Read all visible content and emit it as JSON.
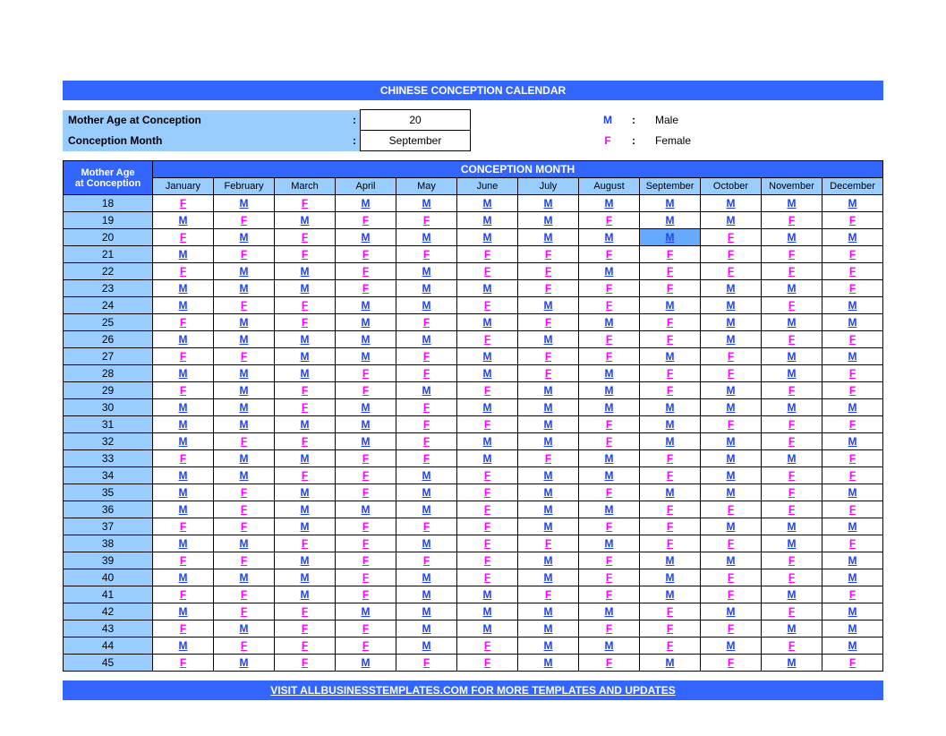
{
  "title": "CHINESE CONCEPTION CALENDAR",
  "inputs": {
    "age_label": "Mother Age at Conception",
    "age_value": "20",
    "month_label": "Conception Month",
    "month_value": "September",
    "colon": ":"
  },
  "legend": {
    "m_key": "M",
    "m_text": "Male",
    "f_key": "F",
    "f_text": "Female",
    "sep": ":"
  },
  "table": {
    "corner_l1": "Mother Age",
    "corner_l2": "at Conception",
    "group": "CONCEPTION MONTH",
    "months": [
      "January",
      "February",
      "March",
      "April",
      "May",
      "June",
      "July",
      "August",
      "September",
      "October",
      "November",
      "December"
    ],
    "highlight": {
      "age": "20",
      "month_index": 8
    }
  },
  "chart_data": {
    "type": "table",
    "title": "Chinese Conception Calendar — predicted gender (M=Male, F=Female)",
    "x_categories": [
      "January",
      "February",
      "March",
      "April",
      "May",
      "June",
      "July",
      "August",
      "September",
      "October",
      "November",
      "December"
    ],
    "y_categories": [
      "18",
      "19",
      "20",
      "21",
      "22",
      "23",
      "24",
      "25",
      "26",
      "27",
      "28",
      "29",
      "30",
      "31",
      "32",
      "33",
      "34",
      "35",
      "36",
      "37",
      "38",
      "39",
      "40",
      "41",
      "42",
      "43",
      "44",
      "45"
    ],
    "rows": [
      {
        "age": "18",
        "v": [
          "F",
          "M",
          "F",
          "M",
          "M",
          "M",
          "M",
          "M",
          "M",
          "M",
          "M",
          "M"
        ]
      },
      {
        "age": "19",
        "v": [
          "M",
          "F",
          "M",
          "F",
          "F",
          "M",
          "M",
          "F",
          "M",
          "M",
          "F",
          "F"
        ]
      },
      {
        "age": "20",
        "v": [
          "F",
          "M",
          "F",
          "M",
          "M",
          "M",
          "M",
          "M",
          "M",
          "F",
          "M",
          "M"
        ]
      },
      {
        "age": "21",
        "v": [
          "M",
          "F",
          "F",
          "F",
          "F",
          "F",
          "F",
          "F",
          "F",
          "F",
          "F",
          "F"
        ]
      },
      {
        "age": "22",
        "v": [
          "F",
          "M",
          "M",
          "F",
          "M",
          "F",
          "F",
          "M",
          "F",
          "F",
          "F",
          "F"
        ]
      },
      {
        "age": "23",
        "v": [
          "M",
          "M",
          "M",
          "F",
          "M",
          "M",
          "F",
          "F",
          "F",
          "M",
          "M",
          "F"
        ]
      },
      {
        "age": "24",
        "v": [
          "M",
          "F",
          "F",
          "M",
          "M",
          "F",
          "M",
          "F",
          "M",
          "M",
          "F",
          "M"
        ]
      },
      {
        "age": "25",
        "v": [
          "F",
          "M",
          "F",
          "M",
          "F",
          "M",
          "F",
          "M",
          "F",
          "M",
          "M",
          "M"
        ]
      },
      {
        "age": "26",
        "v": [
          "M",
          "M",
          "M",
          "M",
          "M",
          "F",
          "M",
          "F",
          "F",
          "M",
          "F",
          "F"
        ]
      },
      {
        "age": "27",
        "v": [
          "F",
          "F",
          "M",
          "M",
          "F",
          "M",
          "F",
          "F",
          "M",
          "F",
          "M",
          "M"
        ]
      },
      {
        "age": "28",
        "v": [
          "M",
          "M",
          "M",
          "F",
          "F",
          "M",
          "F",
          "M",
          "F",
          "F",
          "M",
          "F"
        ]
      },
      {
        "age": "29",
        "v": [
          "F",
          "M",
          "F",
          "F",
          "M",
          "F",
          "M",
          "M",
          "F",
          "M",
          "F",
          "F"
        ]
      },
      {
        "age": "30",
        "v": [
          "M",
          "M",
          "F",
          "M",
          "F",
          "M",
          "M",
          "M",
          "M",
          "M",
          "M",
          "M"
        ]
      },
      {
        "age": "31",
        "v": [
          "M",
          "M",
          "M",
          "M",
          "F",
          "F",
          "M",
          "F",
          "M",
          "F",
          "F",
          "F"
        ]
      },
      {
        "age": "32",
        "v": [
          "M",
          "F",
          "F",
          "M",
          "F",
          "M",
          "M",
          "F",
          "M",
          "M",
          "F",
          "M"
        ]
      },
      {
        "age": "33",
        "v": [
          "F",
          "M",
          "M",
          "F",
          "F",
          "M",
          "F",
          "M",
          "F",
          "M",
          "M",
          "F"
        ]
      },
      {
        "age": "34",
        "v": [
          "M",
          "M",
          "F",
          "F",
          "M",
          "F",
          "M",
          "M",
          "F",
          "M",
          "F",
          "F"
        ]
      },
      {
        "age": "35",
        "v": [
          "M",
          "F",
          "M",
          "F",
          "M",
          "F",
          "M",
          "F",
          "M",
          "M",
          "F",
          "M"
        ]
      },
      {
        "age": "36",
        "v": [
          "M",
          "F",
          "M",
          "M",
          "M",
          "F",
          "M",
          "M",
          "F",
          "F",
          "F",
          "F"
        ]
      },
      {
        "age": "37",
        "v": [
          "F",
          "F",
          "M",
          "F",
          "F",
          "F",
          "M",
          "F",
          "F",
          "M",
          "M",
          "M"
        ]
      },
      {
        "age": "38",
        "v": [
          "M",
          "M",
          "F",
          "F",
          "M",
          "F",
          "F",
          "M",
          "F",
          "F",
          "M",
          "F"
        ]
      },
      {
        "age": "39",
        "v": [
          "F",
          "F",
          "M",
          "F",
          "F",
          "F",
          "M",
          "F",
          "M",
          "M",
          "F",
          "M"
        ]
      },
      {
        "age": "40",
        "v": [
          "M",
          "M",
          "M",
          "F",
          "M",
          "F",
          "M",
          "F",
          "M",
          "F",
          "F",
          "M"
        ]
      },
      {
        "age": "41",
        "v": [
          "F",
          "F",
          "M",
          "F",
          "M",
          "M",
          "F",
          "F",
          "M",
          "F",
          "M",
          "F"
        ]
      },
      {
        "age": "42",
        "v": [
          "M",
          "F",
          "F",
          "M",
          "M",
          "M",
          "M",
          "M",
          "F",
          "M",
          "F",
          "M"
        ]
      },
      {
        "age": "43",
        "v": [
          "F",
          "M",
          "F",
          "F",
          "M",
          "M",
          "M",
          "F",
          "F",
          "F",
          "M",
          "M"
        ]
      },
      {
        "age": "44",
        "v": [
          "M",
          "F",
          "F",
          "F",
          "M",
          "F",
          "M",
          "M",
          "F",
          "M",
          "F",
          "M"
        ]
      },
      {
        "age": "45",
        "v": [
          "F",
          "M",
          "F",
          "M",
          "F",
          "F",
          "M",
          "F",
          "M",
          "F",
          "M",
          "F"
        ]
      }
    ]
  },
  "footer": "VISIT ALLBUSINESSTEMPLATES.COM FOR MORE TEMPLATES AND UPDATES"
}
